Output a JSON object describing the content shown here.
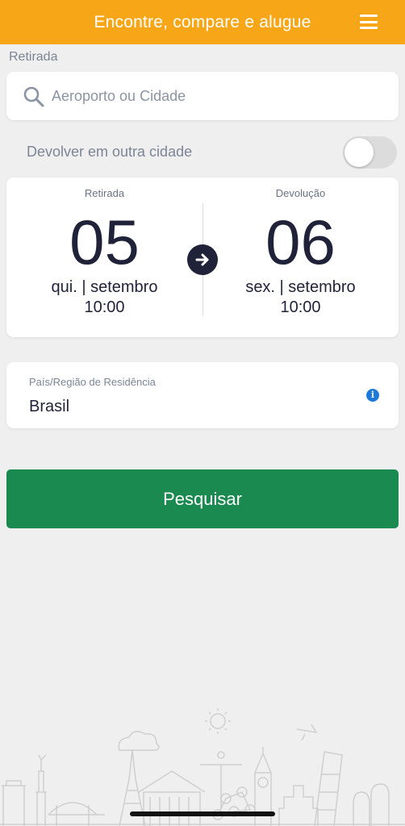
{
  "header": {
    "title": "Encontre, compare e alugue",
    "menu_icon": "hamburger-menu-icon",
    "background": "#f6a617"
  },
  "pickup_section_label": "Retirada",
  "search": {
    "placeholder": "Aeroporto ou Cidade",
    "value": "",
    "icon": "search-icon"
  },
  "return_other_city": {
    "label": "Devolver em outra cidade",
    "enabled": false
  },
  "dates": {
    "pickup": {
      "heading": "Retirada",
      "day": "05",
      "weekday_month": "qui. | setembro",
      "time": "10:00"
    },
    "return": {
      "heading": "Devolução",
      "day": "06",
      "weekday_month": "sex. | setembro",
      "time": "10:00"
    },
    "arrow_icon": "arrow-right-icon"
  },
  "residence": {
    "label": "País/Região de Residência",
    "value": "Brasil",
    "info_icon": "info-icon",
    "info_glyph": "i"
  },
  "search_button": {
    "label": "Pesquisar",
    "color": "#1b8a51"
  }
}
